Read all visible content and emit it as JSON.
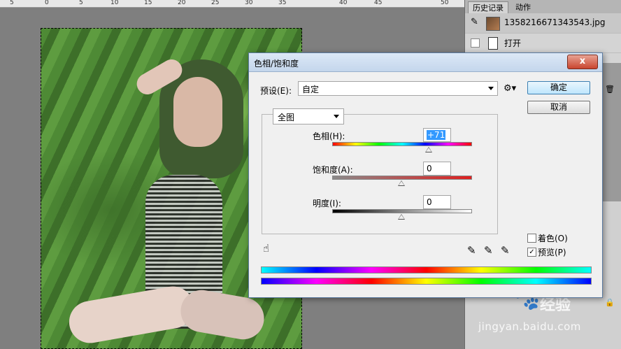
{
  "ruler": {
    "numbers": [
      "5",
      "0",
      "5",
      "10",
      "15",
      "20",
      "25",
      "30",
      "35",
      "40",
      "45",
      "50"
    ]
  },
  "history_panel": {
    "tabs": [
      "历史记录",
      "动作"
    ],
    "items": [
      {
        "label": "1358216671343543.jpg"
      },
      {
        "label": "打开"
      }
    ]
  },
  "watermark": {
    "brand": "经验",
    "url": "jingyan.baidu.com"
  },
  "dialog": {
    "title": "色相/饱和度",
    "close_label": "x",
    "preset_label": "预设(E):",
    "preset_value": "自定",
    "ok_label": "确定",
    "cancel_label": "取消",
    "range_value": "全图",
    "hue": {
      "label": "色相(H):",
      "value": "+71",
      "level": 71
    },
    "saturation": {
      "label": "饱和度(A):",
      "value": "0",
      "level": 0
    },
    "lightness": {
      "label": "明度(I):",
      "value": "0",
      "level": 0
    },
    "colorize": {
      "label": "着色(O)",
      "checked": false
    },
    "preview": {
      "label": "预览(P)",
      "checked": true
    }
  },
  "colors": {
    "ok_border": "#3c7fb1",
    "selection_highlight": "#3399ff"
  }
}
